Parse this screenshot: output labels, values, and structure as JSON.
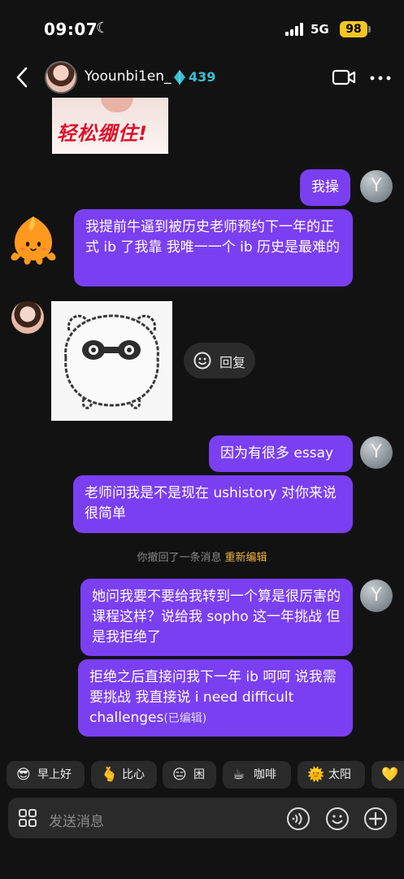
{
  "status": {
    "time": "09:07",
    "network": "5G",
    "battery": "98"
  },
  "header": {
    "username": "Yoounbi1en_",
    "gem_count": "439"
  },
  "sticker_top": {
    "text": "轻松绷住!"
  },
  "messages": {
    "m1": "我操",
    "m2": "我提前牛逼到被历史老师预约下一年的正式 ib 了我靠 我唯一一个 ib 历史是最难的",
    "m3": "因为有很多 essay",
    "m4": "老师问我是不是现在 ushistory 对你来说很简单",
    "m5": "她问我要不要给我转到一个算是很厉害的课程这样？说给我 sopho 这一年挑战 但是我拒绝了",
    "m6": "拒绝之后直接问我下一年 ib 呵呵 说我需要挑战 我直接说 i need difficult challenges",
    "m6_edited": "(已编辑)"
  },
  "avatar_letter": "Y",
  "reply_chip": {
    "label": "回复"
  },
  "recall": {
    "text": "你撤回了一条消息",
    "action": "重新编辑"
  },
  "quick_replies": [
    {
      "emoji": "😎",
      "label": "早上好"
    },
    {
      "emoji": "🫰",
      "label": "比心"
    },
    {
      "emoji": "😑",
      "label": "困"
    },
    {
      "emoji": "☕",
      "label": "咖啡"
    },
    {
      "emoji": "🌞",
      "label": "太阳"
    },
    {
      "emoji": "💛",
      "label": ""
    }
  ],
  "input": {
    "placeholder": "发送消息"
  },
  "colors": {
    "bubble": "#7b3ff2",
    "background": "#121212",
    "accent_gem": "#36c2d4",
    "battery": "#f3c623",
    "recall_action": "#f2b53a"
  }
}
